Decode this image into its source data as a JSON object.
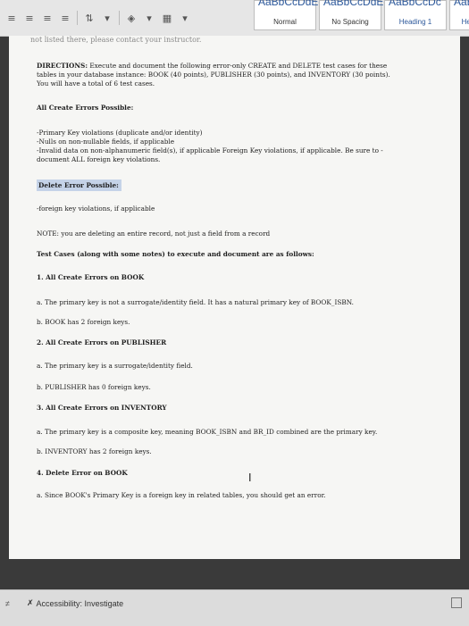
{
  "toolbar": {
    "icons": [
      "align-left-icon",
      "align-center-icon",
      "align-right-icon",
      "justify-icon",
      "line-spacing-icon",
      "shading-icon",
      "borders-icon"
    ],
    "styles": [
      {
        "sample": "AaBbCcDdEe",
        "name": "Normal"
      },
      {
        "sample": "AaBbCcDdEe",
        "name": "No Spacing"
      },
      {
        "sample": "AaBbCcDc",
        "name": "Heading 1"
      },
      {
        "sample": "AaBb",
        "name": "Hea"
      }
    ]
  },
  "document": {
    "top_cutoff": "not listed there, please contact your instructor.",
    "directions_label": "DIRECTIONS:",
    "directions_line1": " Execute and document the following error-only CREATE and DELETE test cases for these",
    "directions_line2": "tables in your database instance: BOOK (40 points), PUBLISHER (30 points), and INVENTORY (30 points).",
    "directions_line3": "You will have a total of 6 test cases.",
    "create_heading": "All Create Errors Possible:",
    "create_item1": "-Primary Key violations (duplicate and/or identity)",
    "create_item2": "-Nulls on non-nullable fields, if applicable",
    "create_item3": "-Invalid data on non-alphanumeric field(s), if applicable Foreign Key violations, if applicable. Be sure to -",
    "create_item3b": "document ALL foreign key violations.",
    "delete_heading": "Delete Error Possible:",
    "delete_item1": "-foreign key violations, if applicable",
    "note": "NOTE: you are deleting an entire record, not just a field from a record",
    "test_cases_heading": "Test Cases (along with some notes) to execute and document are as follows:",
    "s1_heading": "1. All Create Errors on BOOK",
    "s1_a": "a. The primary key is not a surrogate/identity field. It has a natural primary key of BOOK_ISBN.",
    "s1_b": "b. BOOK has 2 foreign keys.",
    "s2_heading": "2. All Create Errors on PUBLISHER",
    "s2_a": "a. The primary key is a surrogate/identity field.",
    "s2_b": "b. PUBLISHER has 0 foreign keys.",
    "s3_heading": "3. All Create Errors on INVENTORY",
    "s3_a": "a. The primary key is a composite key, meaning BOOK_ISBN and BR_ID combined are the primary key.",
    "s3_b": "b. INVENTORY has 2 foreign keys.",
    "s4_heading": "4. Delete Error on BOOK",
    "s4_a": "a. Since BOOK's Primary Key is a foreign key in related tables, you should get an error."
  },
  "statusbar": {
    "accessibility": "Accessibility: Investigate"
  }
}
